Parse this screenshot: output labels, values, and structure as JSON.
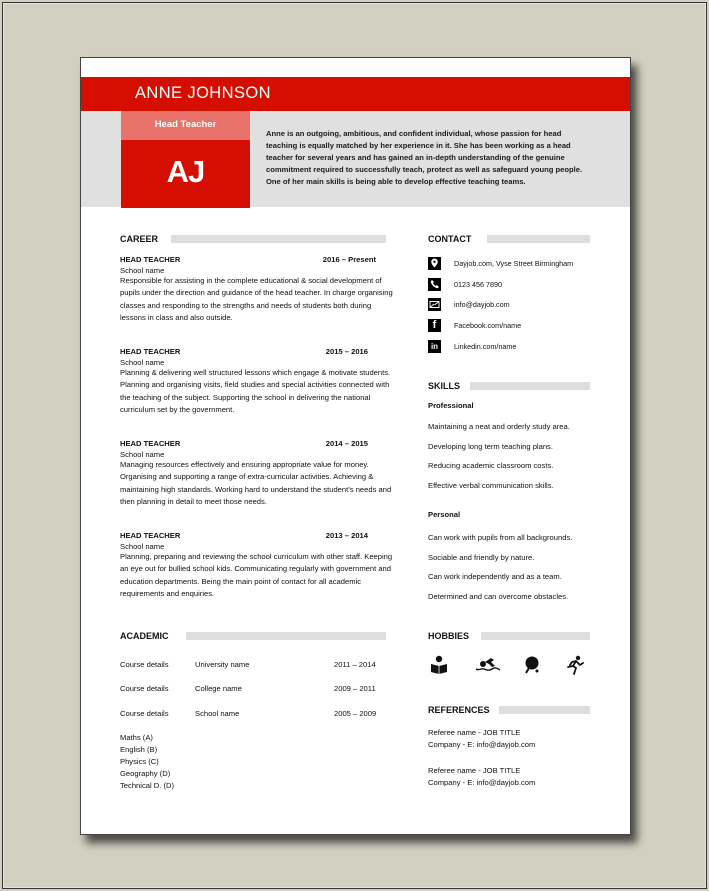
{
  "header": {
    "name": "ANNE JOHNSON",
    "role": "Head Teacher",
    "initials": "AJ",
    "summary": "Anne is an outgoing, ambitious, and confident individual, whose passion for head teaching is equally matched by her experience in it. She has been working as a head teacher for several years and has gained an in-depth understanding of the genuine commitment required to successfully teach, protect as well as safeguard young people. One of her main skills is being able to develop effective teaching teams."
  },
  "colors": {
    "accent_red": "#d40e00",
    "accent_pink": "#e8736b",
    "band_grey": "#e0e0e0",
    "backdrop": "#d2d0c0"
  },
  "career": {
    "title": "CAREER",
    "jobs": [
      {
        "title": "HEAD TEACHER",
        "dates": "2016 – Present",
        "school": "School name",
        "description": "Responsible for assisting in the complete educational & social development of pupils under the direction and guidance of the head teacher. In charge organising classes and responding to the strengths and needs of students both during lessons in class and also outside."
      },
      {
        "title": "HEAD TEACHER",
        "dates": "2015 – 2016",
        "school": "School name",
        "description": "Planning & delivering well structured lessons which engage & motivate students. Planning and organising visits, field studies and special activities connected with the teaching of the subject. Supporting the school in delivering the national curriculum set by the government."
      },
      {
        "title": "HEAD TEACHER",
        "dates": "2014 – 2015",
        "school": "School name",
        "description": "Managing resources effectively and ensuring appropriate value for money. Organising and supporting a range of extra-curricular activities. Achieving & maintaining high standards. Working hard to understand the student’s needs and then planning in detail to meet those needs."
      },
      {
        "title": "HEAD TEACHER",
        "dates": "2013 – 2014",
        "school": "School name",
        "description": "Planning, preparing and reviewing the school curriculum with other staff. Keeping an eye out for bullied school kids. Communicating regularly with government and education departments. Being the main point of contact for all academic requirements and enquiries."
      }
    ]
  },
  "academic": {
    "title": "ACADEMIC",
    "entries": [
      {
        "course": "Course details",
        "institution": "University name",
        "dates": "2011 – 2014"
      },
      {
        "course": "Course details",
        "institution": "College name",
        "dates": "2009 – 2011"
      },
      {
        "course": "Course details",
        "institution": "School name",
        "dates": "2005 – 2009"
      }
    ],
    "grades": [
      "Maths (A)",
      "English (B)",
      "Physics (C)",
      "Geography (D)",
      "Technical D. (D)"
    ]
  },
  "contact": {
    "title": "CONTACT",
    "items": [
      {
        "icon": "location-pin-icon",
        "text": "Dayjob.com, Vyse Street Birmingham"
      },
      {
        "icon": "phone-icon",
        "text": "0123 456 7890"
      },
      {
        "icon": "email-icon",
        "text": "info@dayjob.com"
      },
      {
        "icon": "facebook-icon",
        "text": "Facebook.com/name"
      },
      {
        "icon": "linkedin-icon",
        "text": "Linkedin.com/name"
      }
    ]
  },
  "skills": {
    "title": "SKILLS",
    "professional_label": "Professional",
    "professional": [
      "Maintaining a neat and orderly study area.",
      "Developing long term teaching plans.",
      "Reducing academic classroom costs.",
      "Effective verbal communication skills."
    ],
    "personal_label": "Personal",
    "personal": [
      "Can work with pupils from all backgrounds.",
      "Sociable and friendly by nature.",
      "Can work independently and as a team.",
      "Determined and can overcome obstacles."
    ]
  },
  "hobbies": {
    "title": "HOBBIES",
    "icons": [
      "reading-icon",
      "swimming-icon",
      "table-tennis-icon",
      "running-icon"
    ]
  },
  "references": {
    "title": "REFERENCES",
    "items": [
      {
        "line1": "Referee name - JOB TITLE",
        "line2": "Company - E: info@dayjob.com"
      },
      {
        "line1": "Referee name - JOB TITLE",
        "line2": "Company - E: info@dayjob.com"
      }
    ]
  }
}
